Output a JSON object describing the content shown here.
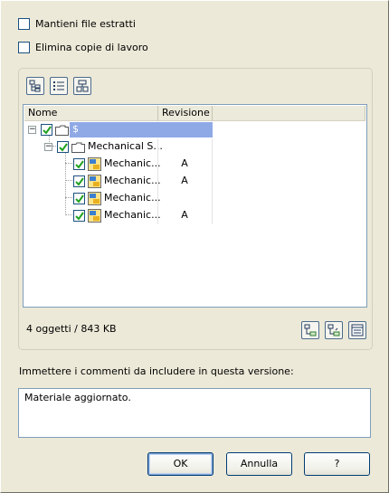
{
  "options": {
    "keep_extracted": {
      "label": "Mantieni file estratti",
      "checked": false
    },
    "delete_working_copies": {
      "label": "Elimina copie di lavoro",
      "checked": false
    }
  },
  "toolbar": {
    "tree_view_icon": "tree-view-icon",
    "list_view_icon": "list-view-icon",
    "grouped_view_icon": "grouped-view-icon"
  },
  "tree": {
    "columns": [
      "Nome",
      "Revisione"
    ],
    "rows": [
      {
        "name": "$",
        "revision": "",
        "level": 0,
        "checked": true,
        "type": "folder",
        "selected": true
      },
      {
        "name": "Mechanical S...",
        "revision": "",
        "level": 1,
        "checked": true,
        "type": "folder"
      },
      {
        "name": "Mechanic...",
        "revision": "A",
        "level": 2,
        "checked": true,
        "type": "file"
      },
      {
        "name": "Mechanic...",
        "revision": "A",
        "level": 2,
        "checked": true,
        "type": "file"
      },
      {
        "name": "Mechanic...",
        "revision": "",
        "level": 2,
        "checked": true,
        "type": "file"
      },
      {
        "name": "Mechanic...",
        "revision": "A",
        "level": 2,
        "checked": true,
        "type": "file"
      }
    ]
  },
  "status": {
    "summary": "4 oggetti / 843 KB"
  },
  "comment": {
    "prompt": "Immettere i commenti da includere in questa versione:",
    "value": "Materiale aggiornato."
  },
  "buttons": {
    "ok": "OK",
    "cancel": "Annulla",
    "help": "?"
  },
  "colors": {
    "selection": "#8fa9e6",
    "check": "#21a121",
    "border": "#7f9db9"
  }
}
